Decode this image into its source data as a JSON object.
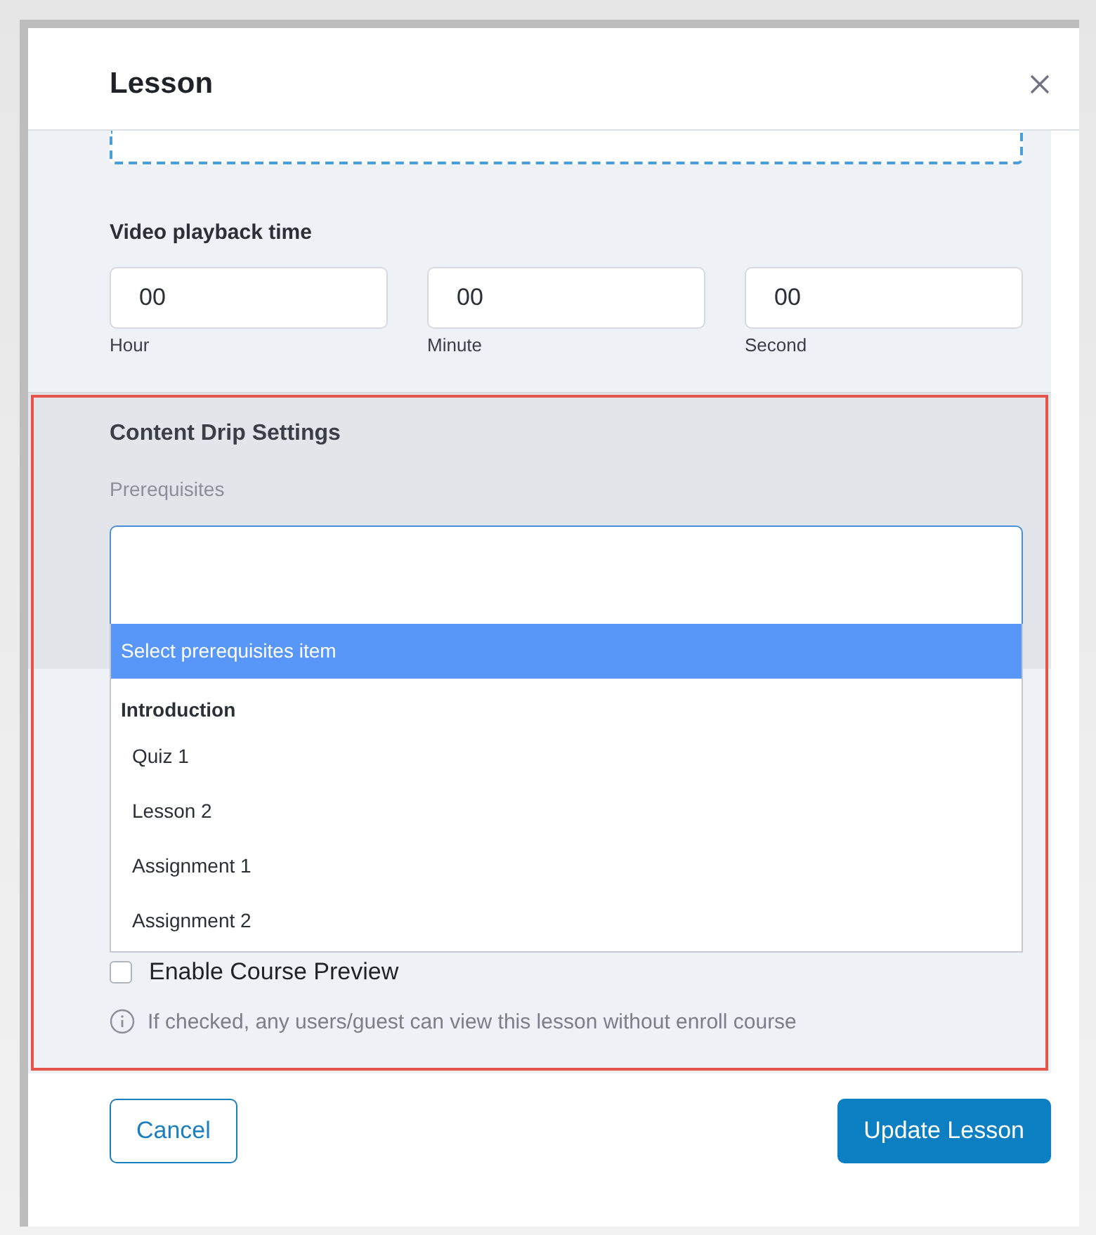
{
  "modal": {
    "title": "Lesson"
  },
  "video_playback": {
    "label": "Video playback time",
    "fields": [
      {
        "value": "00",
        "caption": "Hour"
      },
      {
        "value": "00",
        "caption": "Minute"
      },
      {
        "value": "00",
        "caption": "Second"
      }
    ]
  },
  "content_drip": {
    "title": "Content Drip Settings",
    "highlighted": true,
    "prerequisites": {
      "label": "Prerequisites",
      "expanded": true,
      "items": [
        {
          "kind": "option",
          "label": "Select prerequisites item",
          "selected": true
        },
        {
          "kind": "group",
          "label": "Introduction"
        },
        {
          "kind": "option",
          "label": "Quiz 1",
          "selected": false
        },
        {
          "kind": "option",
          "label": "Lesson 2",
          "selected": false
        },
        {
          "kind": "option",
          "label": "Assignment 1",
          "selected": false
        },
        {
          "kind": "option",
          "label": "Assignment 2",
          "selected": false
        }
      ]
    },
    "course_preview": {
      "label": "Enable Course Preview",
      "checked": false,
      "hint": "If checked, any users/guest can view this lesson without enroll course"
    }
  },
  "buttons": [
    {
      "label": "Cancel",
      "kind": "secondary"
    },
    {
      "label": "Update Lesson",
      "kind": "primary"
    }
  ]
}
